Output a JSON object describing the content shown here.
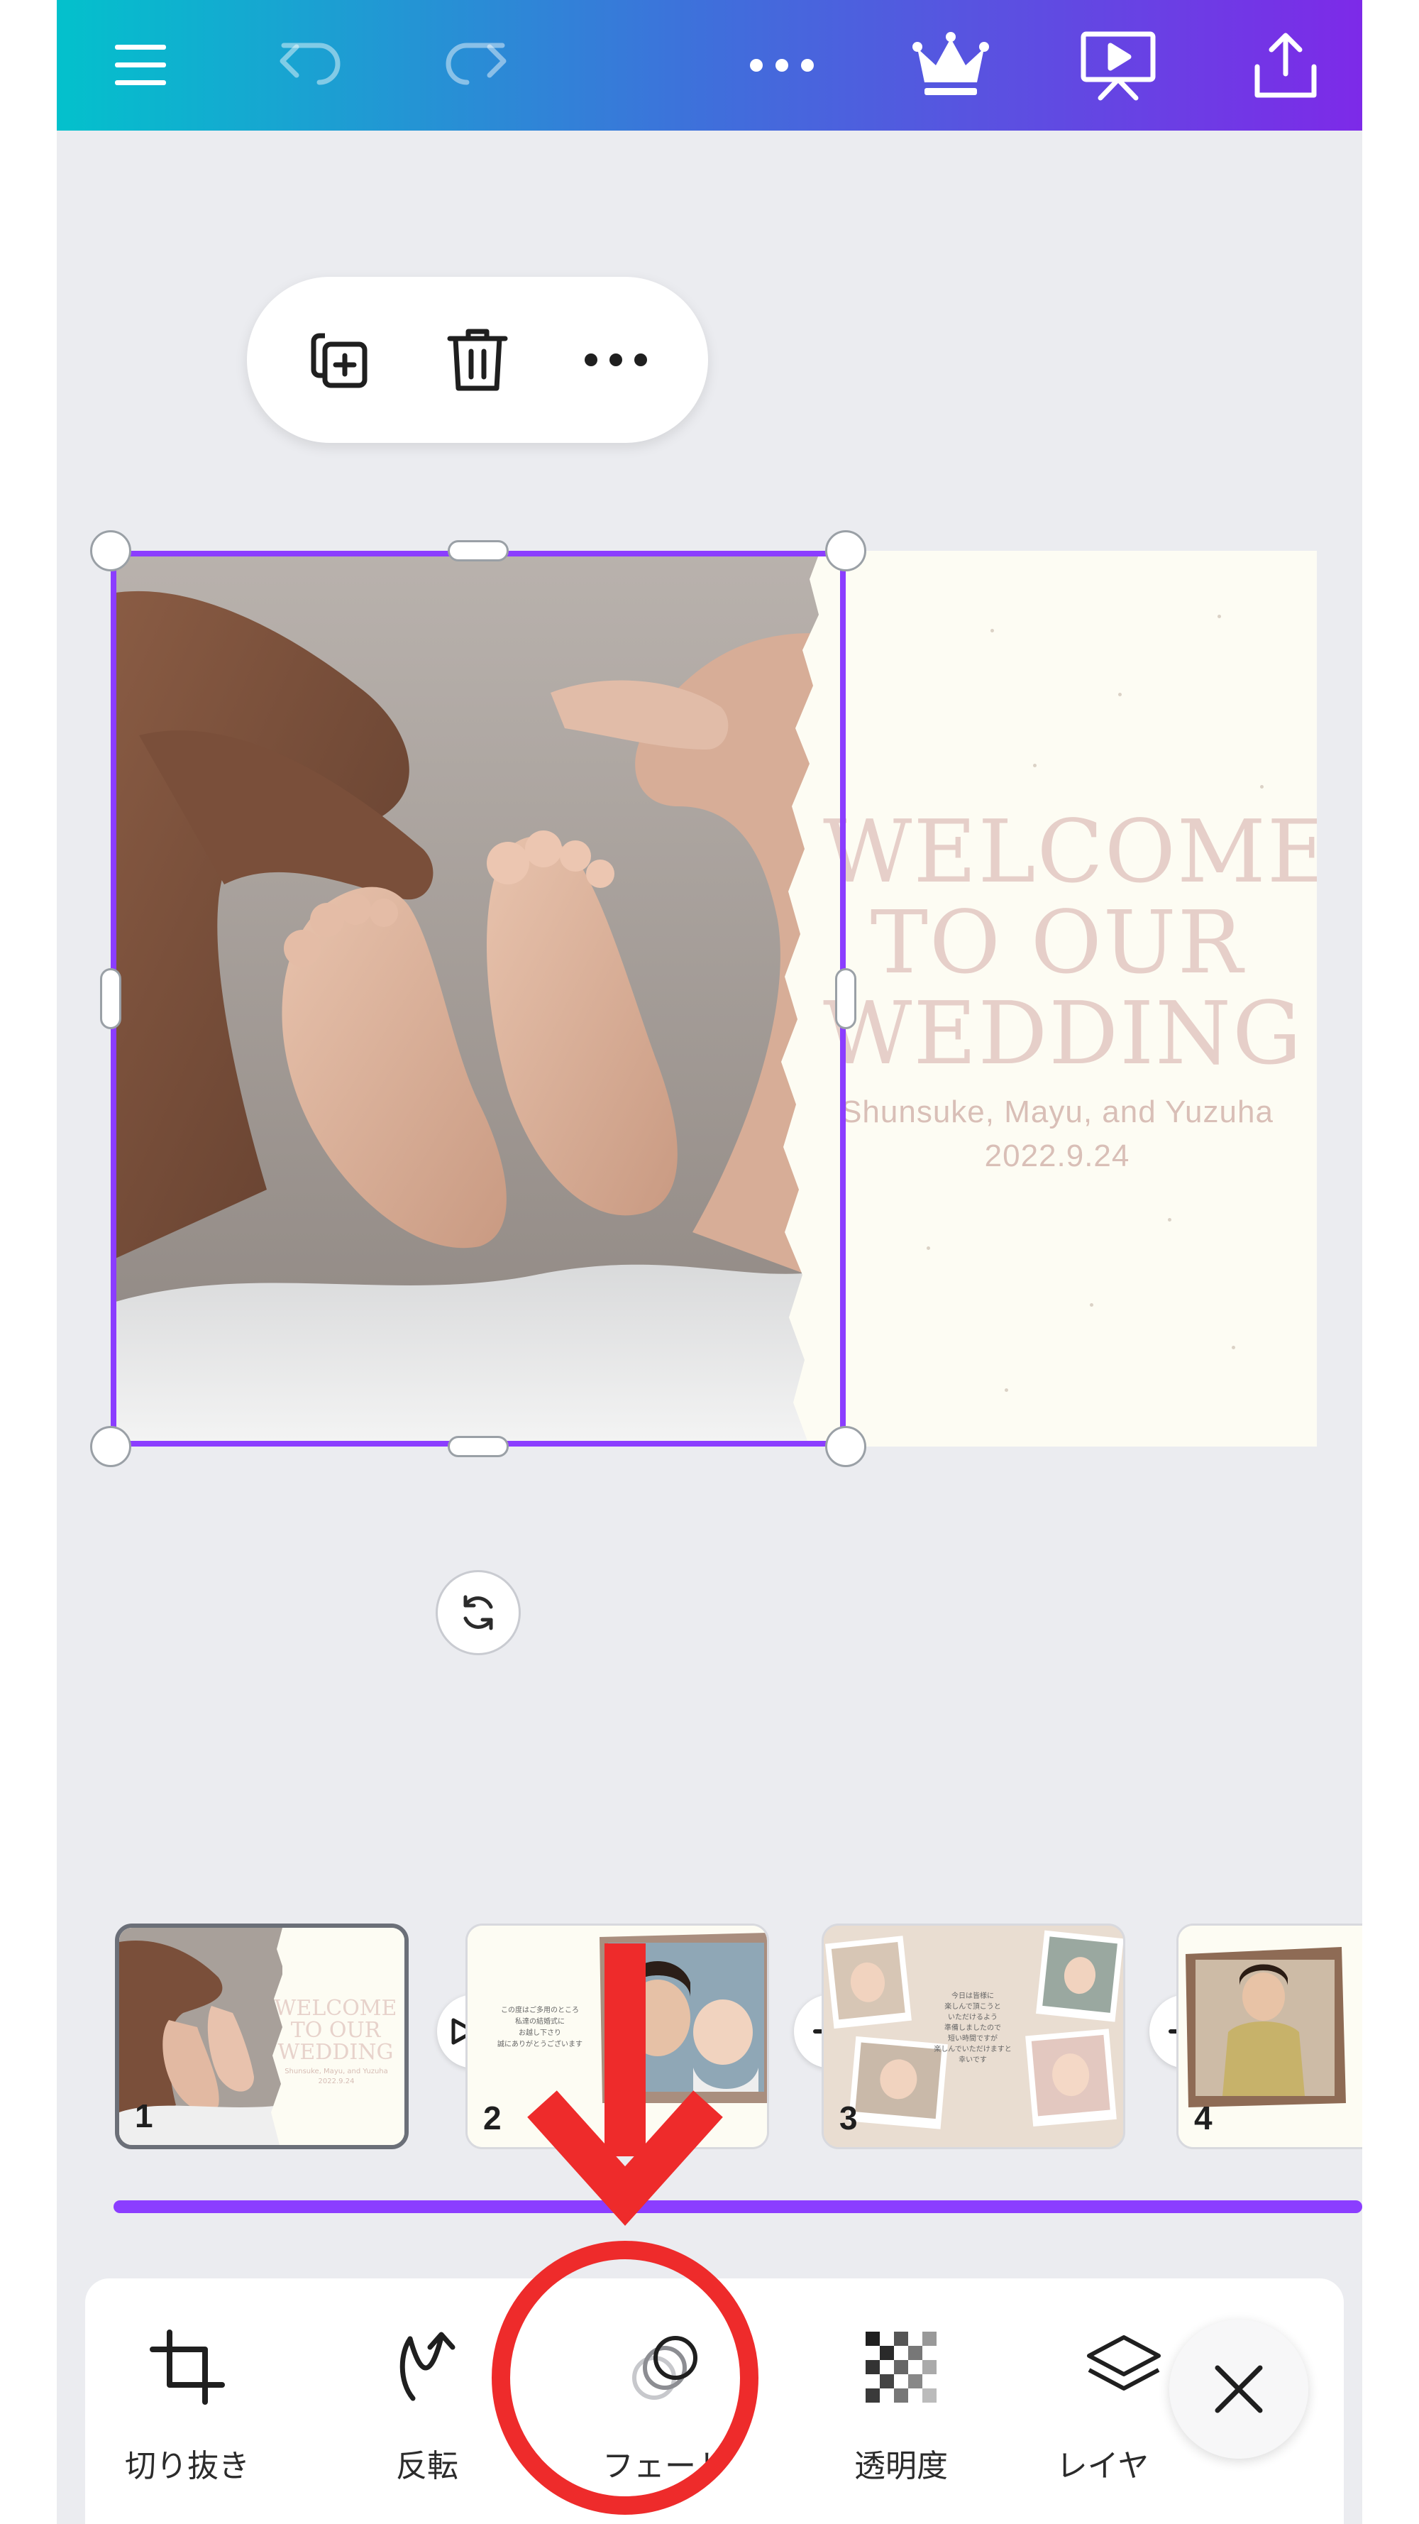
{
  "topbar": {
    "icons": [
      "menu-icon",
      "undo-icon",
      "redo-icon",
      "more-icon",
      "crown-icon",
      "present-icon",
      "share-icon"
    ]
  },
  "context_toolbar": {
    "icons": [
      "duplicate-icon",
      "trash-icon",
      "more-icon"
    ]
  },
  "page": {
    "welcome_lines": [
      "WELCOME",
      "TO OUR",
      "WEDDING"
    ],
    "names": "Shunsuke, Mayu, and Yuzuha",
    "date": "2022.9.24"
  },
  "pages_strip": {
    "thumbs": [
      {
        "number": "1",
        "welcome_lines": [
          "WELCOME",
          "TO OUR",
          "WEDDING"
        ],
        "names": "Shunsuke, Mayu, and Yuzuha",
        "date": "2022.9.24"
      },
      {
        "number": "2",
        "text": [
          "この度はご多用のところ",
          "私達の結婚式に",
          "お越し下さり",
          "誠にありがとうございます"
        ]
      },
      {
        "number": "3",
        "text": [
          "今日は皆様に",
          "楽しんで頂こうと",
          "いただけるよう",
          "準備しましたので",
          "短い時間ですが",
          "楽しんでいただけますと",
          "幸いです"
        ]
      },
      {
        "number": "4"
      }
    ],
    "transition_icon": "bowtie-transition-icon",
    "add_icon": "plus-icon"
  },
  "bottom_toolbar": {
    "items": [
      {
        "label": "切り抜き",
        "icon": "crop-icon"
      },
      {
        "label": "反転",
        "icon": "flip-icon"
      },
      {
        "label": "フェード",
        "icon": "fade-icon"
      },
      {
        "label": "透明度",
        "icon": "transparency-icon"
      },
      {
        "label": "レイヤ",
        "icon": "layers-icon"
      }
    ],
    "close_icon": "close-icon"
  },
  "colors": {
    "accent": "#8b3dff",
    "annotation": "#ee2b2b",
    "gradient_start": "#03c1cc",
    "gradient_end": "#7d2ae8"
  }
}
